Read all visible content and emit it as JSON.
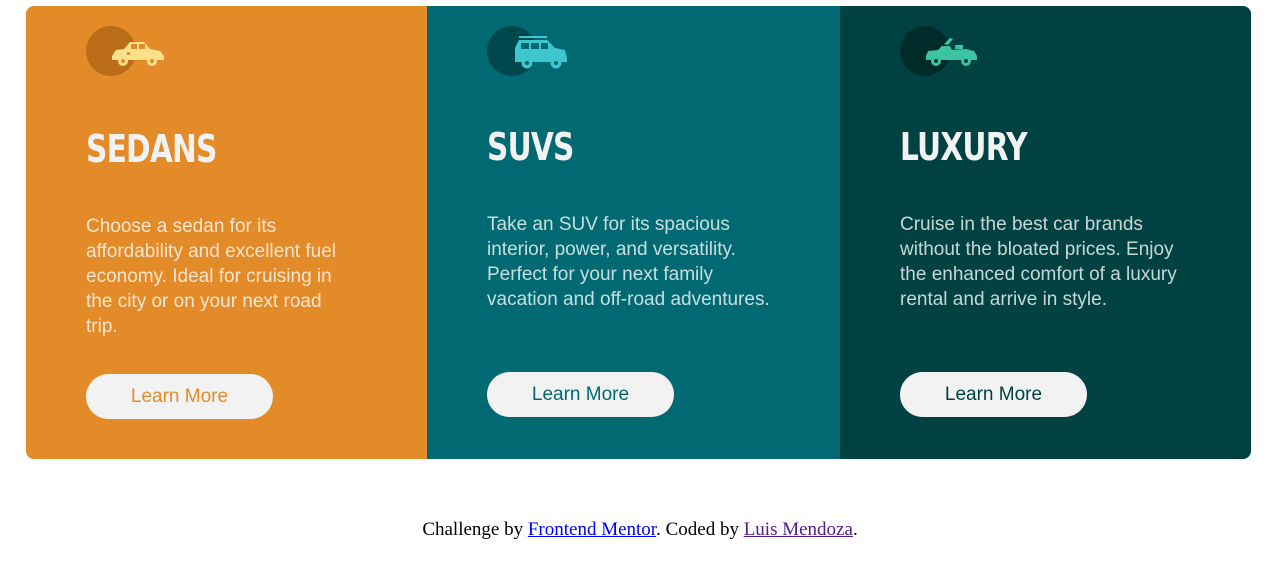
{
  "colors": {
    "sedans_bg": "#e28b28",
    "suvs_bg": "#006971",
    "luxury_bg": "#004241",
    "button_bg": "#f2f2f2",
    "heading": "#f2f2f2"
  },
  "cards": [
    {
      "icon": "sedan-car-icon",
      "title": "SEDANS",
      "description": "Choose a sedan for its affordability and excellent fuel economy. Ideal for cruising in the city or on your next road trip.",
      "button_label": "Learn More"
    },
    {
      "icon": "suv-car-icon",
      "title": "SUVS",
      "description": "Take an SUV for its spacious interior, power, and versatility. Perfect for your next family vacation and off-road adventures.",
      "button_label": "Learn More"
    },
    {
      "icon": "luxury-car-icon",
      "title": "LUXURY",
      "description": "Cruise in the best car brands without the bloated prices. Enjoy the enhanced comfort of a luxury rental and arrive in style.",
      "button_label": "Learn More"
    }
  ],
  "footer": {
    "prefix": "Challenge by",
    "link1": "Frontend Mentor",
    "middle": ". Coded by",
    "link2": "Luis Mendoza",
    "suffix": "."
  }
}
